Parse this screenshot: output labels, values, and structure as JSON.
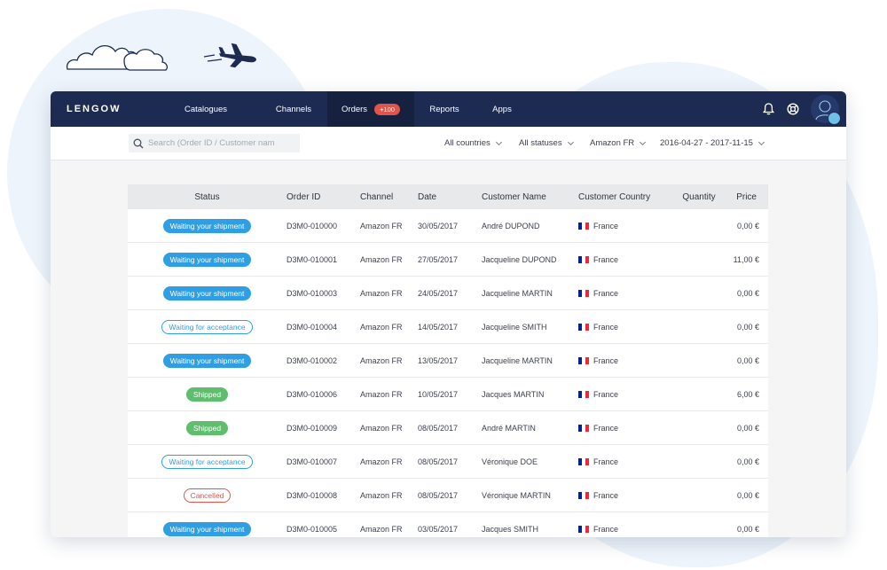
{
  "app": {
    "logo": "LENGOW",
    "nav": [
      {
        "label": "Catalogues",
        "active": false
      },
      {
        "label": "Channels",
        "active": false
      },
      {
        "label": "Orders",
        "active": true,
        "badge": "+100"
      },
      {
        "label": "Reports",
        "active": false
      },
      {
        "label": "Apps",
        "active": false
      }
    ],
    "icons": [
      "bell-icon",
      "support-icon",
      "avatar"
    ]
  },
  "filters": {
    "search_placeholder": "Search (Order ID / Customer nam",
    "country": "All countries",
    "status": "All statuses",
    "channel": "Amazon FR",
    "date_range": "2016-04-27 - 2017-11-15"
  },
  "table": {
    "columns": [
      "Status",
      "Order ID",
      "Channel",
      "Date",
      "Customer Name",
      "Customer Country",
      "Quantity",
      "Price"
    ],
    "rows": [
      {
        "status": "Waiting your shipment",
        "style": "filled-blue",
        "order_id": "D3M0-010000",
        "channel": "Amazon FR",
        "date": "30/05/2017",
        "customer": "André DUPOND",
        "country": "France",
        "quantity": "",
        "price": "0,00 €"
      },
      {
        "status": "Waiting your shipment",
        "style": "filled-blue",
        "order_id": "D3M0-010001",
        "channel": "Amazon FR",
        "date": "27/05/2017",
        "customer": "Jacqueline DUPOND",
        "country": "France",
        "quantity": "",
        "price": "11,00 €"
      },
      {
        "status": "Waiting your shipment",
        "style": "filled-blue",
        "order_id": "D3M0-010003",
        "channel": "Amazon FR",
        "date": "24/05/2017",
        "customer": "Jacqueline MARTIN",
        "country": "France",
        "quantity": "",
        "price": "0,00 €"
      },
      {
        "status": "Waiting for acceptance",
        "style": "outline-blue",
        "order_id": "D3M0-010004",
        "channel": "Amazon FR",
        "date": "14/05/2017",
        "customer": "Jacqueline SMITH",
        "country": "France",
        "quantity": "",
        "price": "0,00 €"
      },
      {
        "status": "Waiting your shipment",
        "style": "filled-blue",
        "order_id": "D3M0-010002",
        "channel": "Amazon FR",
        "date": "13/05/2017",
        "customer": "Jacqueline MARTIN",
        "country": "France",
        "quantity": "",
        "price": "0,00 €"
      },
      {
        "status": "Shipped",
        "style": "filled-green",
        "order_id": "D3M0-010006",
        "channel": "Amazon FR",
        "date": "10/05/2017",
        "customer": "Jacques MARTIN",
        "country": "France",
        "quantity": "",
        "price": "6,00 €"
      },
      {
        "status": "Shipped",
        "style": "filled-green",
        "order_id": "D3M0-010009",
        "channel": "Amazon FR",
        "date": "08/05/2017",
        "customer": "André MARTIN",
        "country": "France",
        "quantity": "",
        "price": "0,00 €"
      },
      {
        "status": "Waiting for acceptance",
        "style": "outline-blue",
        "order_id": "D3M0-010007",
        "channel": "Amazon FR",
        "date": "08/05/2017",
        "customer": "Véronique DOE",
        "country": "France",
        "quantity": "",
        "price": "0,00 €"
      },
      {
        "status": "Cancelled",
        "style": "outline-red",
        "order_id": "D3M0-010008",
        "channel": "Amazon FR",
        "date": "08/05/2017",
        "customer": "Véronique MARTIN",
        "country": "France",
        "quantity": "",
        "price": "0,00 €"
      },
      {
        "status": "Waiting your shipment",
        "style": "filled-blue",
        "order_id": "D3M0-010005",
        "channel": "Amazon FR",
        "date": "03/05/2017",
        "customer": "Jacques SMITH",
        "country": "France",
        "quantity": "",
        "price": "0,00 €"
      }
    ]
  },
  "colors": {
    "navbar": "#1d2b53",
    "navbar_active": "#16213f",
    "badge": "#e0544c",
    "status_blue": "#2f9ee3",
    "status_green": "#5fbe6d",
    "status_red": "#e0544c",
    "flag": [
      "#002395",
      "#ffffff",
      "#ed2939"
    ]
  }
}
